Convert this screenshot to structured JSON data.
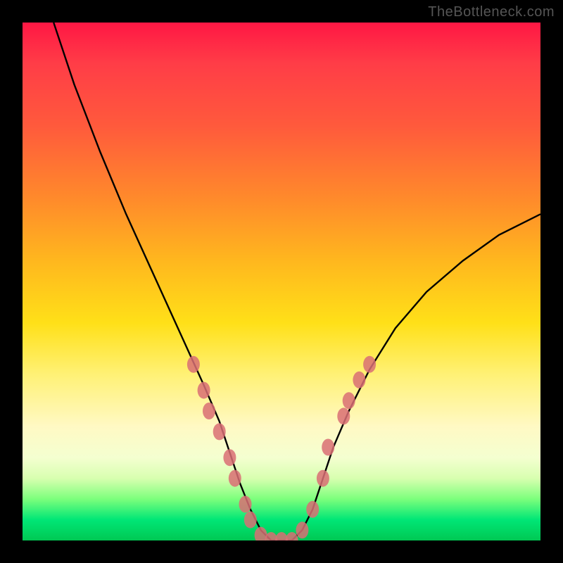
{
  "watermark": "TheBottleneck.com",
  "chart_data": {
    "type": "line",
    "title": "",
    "xlabel": "",
    "ylabel": "",
    "xlim": [
      0,
      100
    ],
    "ylim": [
      0,
      100
    ],
    "grid": false,
    "legend": false,
    "background_gradient": {
      "stops": [
        {
          "pos": 0,
          "color": "#ff1744"
        },
        {
          "pos": 8,
          "color": "#ff3d47"
        },
        {
          "pos": 20,
          "color": "#ff5a3c"
        },
        {
          "pos": 34,
          "color": "#ff8a2b"
        },
        {
          "pos": 46,
          "color": "#ffb71e"
        },
        {
          "pos": 58,
          "color": "#ffe018"
        },
        {
          "pos": 68,
          "color": "#fff176"
        },
        {
          "pos": 78,
          "color": "#fff9c4"
        },
        {
          "pos": 84,
          "color": "#f4ffd0"
        },
        {
          "pos": 88,
          "color": "#d8ffb0"
        },
        {
          "pos": 92,
          "color": "#7cff7c"
        },
        {
          "pos": 96,
          "color": "#00e676"
        },
        {
          "pos": 100,
          "color": "#00c853"
        }
      ]
    },
    "series": [
      {
        "name": "bottleneck-curve",
        "color": "#000000",
        "x": [
          6,
          10,
          15,
          20,
          25,
          30,
          35,
          38,
          40,
          42,
          44,
          46,
          48,
          50,
          52,
          54,
          56,
          58,
          60,
          63,
          67,
          72,
          78,
          85,
          92,
          100
        ],
        "values": [
          100,
          88,
          75,
          63,
          52,
          41,
          30,
          23,
          17,
          11,
          6,
          2,
          0,
          0,
          0,
          2,
          6,
          12,
          18,
          25,
          33,
          41,
          48,
          54,
          59,
          63
        ]
      }
    ],
    "markers": {
      "name": "highlight-dots",
      "color": "#d96f74",
      "points": [
        {
          "x": 33,
          "y": 34
        },
        {
          "x": 35,
          "y": 29
        },
        {
          "x": 36,
          "y": 25
        },
        {
          "x": 38,
          "y": 21
        },
        {
          "x": 40,
          "y": 16
        },
        {
          "x": 41,
          "y": 12
        },
        {
          "x": 43,
          "y": 7
        },
        {
          "x": 44,
          "y": 4
        },
        {
          "x": 46,
          "y": 1
        },
        {
          "x": 48,
          "y": 0
        },
        {
          "x": 50,
          "y": 0
        },
        {
          "x": 52,
          "y": 0
        },
        {
          "x": 54,
          "y": 2
        },
        {
          "x": 56,
          "y": 6
        },
        {
          "x": 58,
          "y": 12
        },
        {
          "x": 59,
          "y": 18
        },
        {
          "x": 62,
          "y": 24
        },
        {
          "x": 63,
          "y": 27
        },
        {
          "x": 65,
          "y": 31
        },
        {
          "x": 67,
          "y": 34
        }
      ]
    }
  }
}
